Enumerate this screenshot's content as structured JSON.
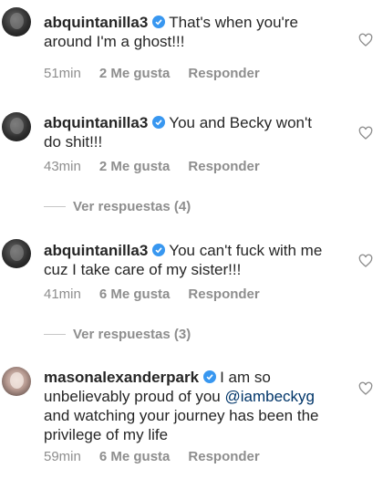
{
  "comments": [
    {
      "username": "abquintanilla3",
      "text_line1": "That's when you're",
      "text_line2": "around I'm a ghost!!!",
      "time": "51min",
      "likes": "2 Me gusta",
      "reply": "Responder"
    },
    {
      "username": "abquintanilla3",
      "text_line1": "You and  Becky won't",
      "text_line2": "do shit!!!",
      "time": "43min",
      "likes": "2 Me gusta",
      "reply": "Responder",
      "view_replies": "Ver respuestas (4)"
    },
    {
      "username": "abquintanilla3",
      "text_line1": "You can't fuck with me",
      "text_line2": "cuz I take care of my sister!!!",
      "time": "41min",
      "likes": "6 Me gusta",
      "reply": "Responder",
      "view_replies": "Ver respuestas (3)"
    },
    {
      "username": "masonalexanderpark",
      "text_line1": "I am so",
      "text_line2_before": "unbelievably proud of you ",
      "mention": "@iambeckyg",
      "text_line3": "and watching your journey has been the",
      "text_line4": "privilege of my life",
      "time": "59min",
      "likes": "6 Me gusta",
      "reply": "Responder"
    }
  ],
  "icons": {
    "verified": "verified-badge-icon",
    "like": "heart-outline-icon"
  },
  "colors": {
    "verified": "#3897f0",
    "mention": "#003569",
    "meta": "#8e8e8e"
  }
}
